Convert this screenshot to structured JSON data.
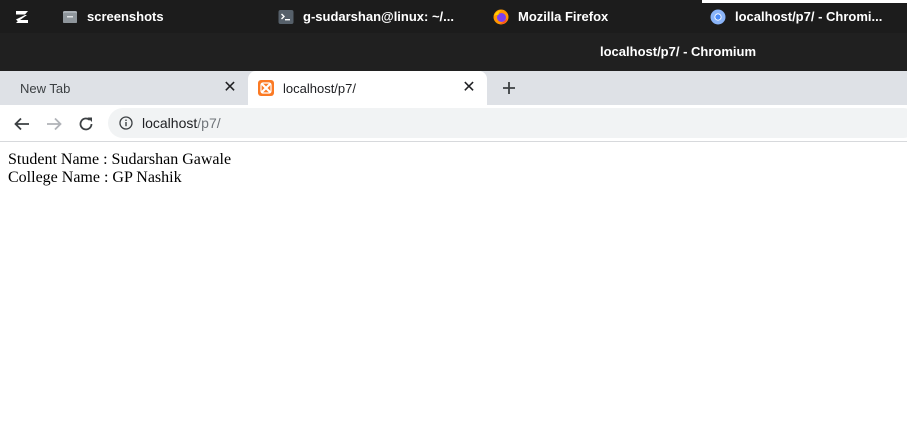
{
  "taskbar": {
    "items": [
      {
        "label": "screenshots",
        "icon": "folder-icon"
      },
      {
        "label": "g-sudarshan@linux: ~/...",
        "icon": "terminal-icon"
      },
      {
        "label": "Mozilla Firefox",
        "icon": "firefox-icon"
      },
      {
        "label": "localhost/p7/ - Chromi...",
        "icon": "chromium-icon"
      }
    ]
  },
  "window": {
    "title": "localhost/p7/ - Chromium"
  },
  "tabs": [
    {
      "label": "New Tab",
      "active": false
    },
    {
      "label": "localhost/p7/",
      "active": true
    }
  ],
  "address_bar": {
    "host": "localhost",
    "path": "/p7/"
  },
  "page": {
    "lines": [
      "Student Name : Sudarshan Gawale",
      "College Name : GP Nashik"
    ]
  },
  "colors": {
    "taskbar_bg": "#1c1c1c",
    "titlebar_bg": "#202020",
    "tabstrip_bg": "#dee1e6",
    "omnibox_bg": "#f1f3f4",
    "xampp_orange": "#fb7a24"
  }
}
